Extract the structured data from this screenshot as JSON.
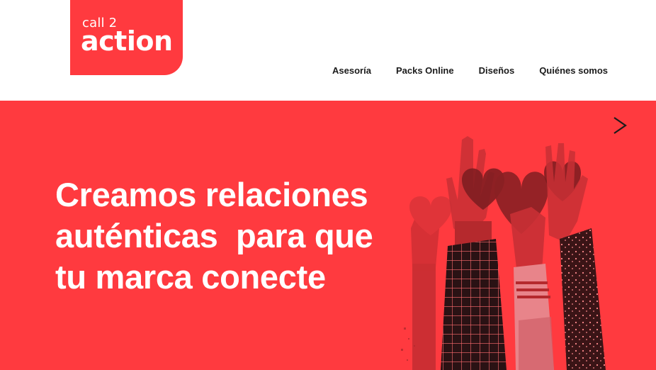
{
  "logo": {
    "top": "call 2",
    "bottom": "action"
  },
  "nav": {
    "items": [
      {
        "label": "Asesoría"
      },
      {
        "label": "Packs Online"
      },
      {
        "label": "Diseños"
      },
      {
        "label": "Quiénes somos"
      }
    ]
  },
  "hero": {
    "headline_lines": [
      "Creamos relaciones",
      "auténticas  para que",
      "tu marca conecte"
    ],
    "background_color": "#ff3a3f",
    "illustration": "raised-hands-with-hearts",
    "next_control": "chevron-right-icon"
  },
  "colors": {
    "brand_red": "#ff3a3f",
    "dark_red": "#8a2024",
    "nav_text": "#1b1b1b"
  }
}
